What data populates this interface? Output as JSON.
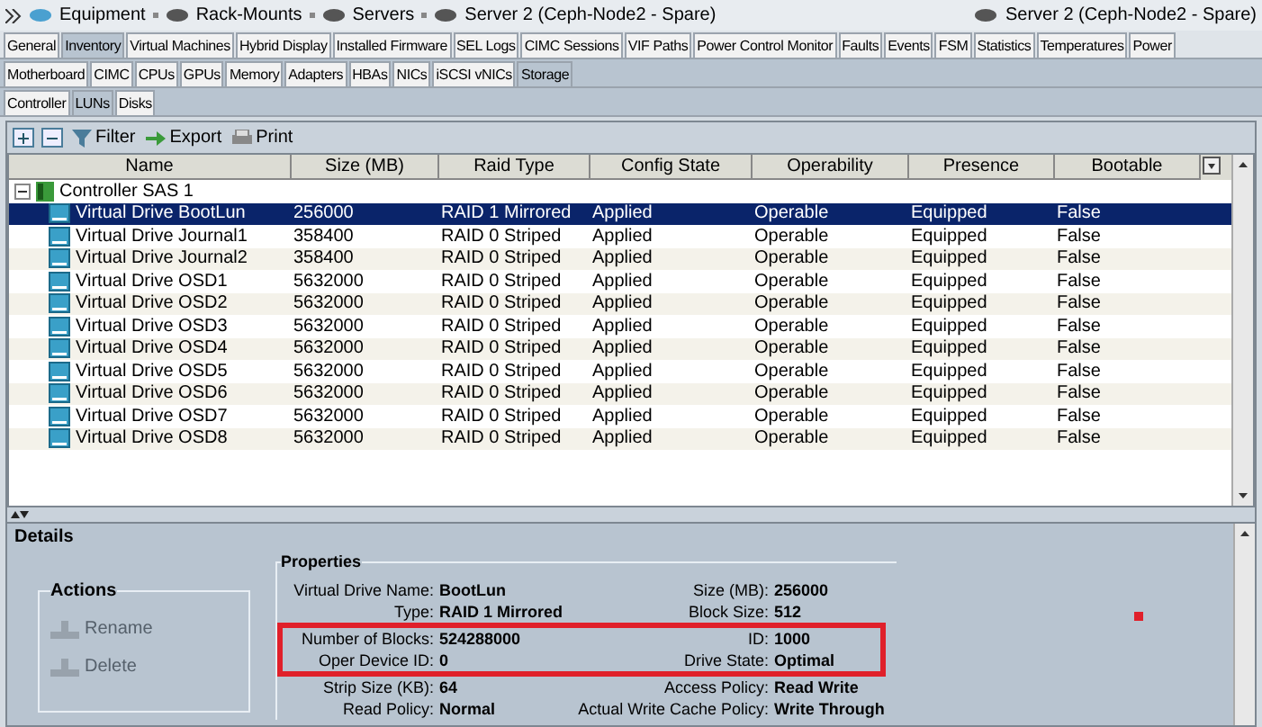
{
  "breadcrumb": {
    "items": [
      "Equipment",
      "Rack-Mounts",
      "Servers",
      "Server 2 (Ceph-Node2 - Spare)"
    ],
    "title": "Server 2 (Ceph-Node2 - Spare)"
  },
  "tabs": [
    {
      "label": "General",
      "selected": false
    },
    {
      "label": "Inventory",
      "selected": true
    },
    {
      "label": "Virtual Machines",
      "selected": false
    },
    {
      "label": "Hybrid Display",
      "selected": false
    },
    {
      "label": "Installed Firmware",
      "selected": false
    },
    {
      "label": "SEL Logs",
      "selected": false
    },
    {
      "label": "CIMC Sessions",
      "selected": false
    },
    {
      "label": "VIF Paths",
      "selected": false
    },
    {
      "label": "Power Control Monitor",
      "selected": false
    },
    {
      "label": "Faults",
      "selected": false
    },
    {
      "label": "Events",
      "selected": false
    },
    {
      "label": "FSM",
      "selected": false
    },
    {
      "label": "Statistics",
      "selected": false
    },
    {
      "label": "Temperatures",
      "selected": false
    },
    {
      "label": "Power",
      "selected": false
    }
  ],
  "subtabs": [
    {
      "label": "Motherboard",
      "selected": false
    },
    {
      "label": "CIMC",
      "selected": false
    },
    {
      "label": "CPUs",
      "selected": false
    },
    {
      "label": "GPUs",
      "selected": false
    },
    {
      "label": "Memory",
      "selected": false
    },
    {
      "label": "Adapters",
      "selected": false
    },
    {
      "label": "HBAs",
      "selected": false
    },
    {
      "label": "NICs",
      "selected": false
    },
    {
      "label": "iSCSI vNICs",
      "selected": false
    },
    {
      "label": "Storage",
      "selected": true
    }
  ],
  "storage_tabs": [
    {
      "label": "Controller",
      "selected": false
    },
    {
      "label": "LUNs",
      "selected": true
    },
    {
      "label": "Disks",
      "selected": false
    }
  ],
  "toolbar": {
    "buttons": [
      "Filter",
      "Export",
      "Print"
    ]
  },
  "table": {
    "columns": [
      "Name",
      "Size (MB)",
      "Raid Type",
      "Config State",
      "Operability",
      "Presence",
      "Bootable"
    ],
    "tree": [
      {
        "name": "Controller SAS 1",
        "expanded": true,
        "children": [
          {
            "cells": [
              "Virtual Drive BootLun",
              "256000",
              "RAID 1 Mirrored",
              "Applied",
              "Operable",
              "Equipped",
              "False"
            ],
            "selected": true
          },
          {
            "cells": [
              "Virtual Drive Journal1",
              "358400",
              "RAID 0 Striped",
              "Applied",
              "Operable",
              "Equipped",
              "False"
            ],
            "selected": false
          },
          {
            "cells": [
              "Virtual Drive Journal2",
              "358400",
              "RAID 0 Striped",
              "Applied",
              "Operable",
              "Equipped",
              "False"
            ],
            "selected": false
          },
          {
            "cells": [
              "Virtual Drive OSD1",
              "5632000",
              "RAID 0 Striped",
              "Applied",
              "Operable",
              "Equipped",
              "False"
            ],
            "selected": false
          },
          {
            "cells": [
              "Virtual Drive OSD2",
              "5632000",
              "RAID 0 Striped",
              "Applied",
              "Operable",
              "Equipped",
              "False"
            ],
            "selected": false
          },
          {
            "cells": [
              "Virtual Drive OSD3",
              "5632000",
              "RAID 0 Striped",
              "Applied",
              "Operable",
              "Equipped",
              "False"
            ],
            "selected": false
          },
          {
            "cells": [
              "Virtual Drive OSD4",
              "5632000",
              "RAID 0 Striped",
              "Applied",
              "Operable",
              "Equipped",
              "False"
            ],
            "selected": false
          },
          {
            "cells": [
              "Virtual Drive OSD5",
              "5632000",
              "RAID 0 Striped",
              "Applied",
              "Operable",
              "Equipped",
              "False"
            ],
            "selected": false
          },
          {
            "cells": [
              "Virtual Drive OSD6",
              "5632000",
              "RAID 0 Striped",
              "Applied",
              "Operable",
              "Equipped",
              "False"
            ],
            "selected": false
          },
          {
            "cells": [
              "Virtual Drive OSD7",
              "5632000",
              "RAID 0 Striped",
              "Applied",
              "Operable",
              "Equipped",
              "False"
            ],
            "selected": false
          },
          {
            "cells": [
              "Virtual Drive OSD8",
              "5632000",
              "RAID 0 Striped",
              "Applied",
              "Operable",
              "Equipped",
              "False"
            ],
            "selected": false
          }
        ]
      }
    ]
  },
  "details": {
    "title": "Details",
    "actions": {
      "title": "Actions",
      "items": [
        {
          "label": "Rename",
          "disabled": true
        },
        {
          "label": "Delete",
          "disabled": true
        }
      ]
    },
    "properties": {
      "title": "Properties",
      "groups": [
        {
          "highlighted": false,
          "rows": [
            {
              "left": {
                "label": "Virtual Drive Name:",
                "value": "BootLun"
              },
              "right": {
                "label": "Size (MB):",
                "value": "256000"
              }
            },
            {
              "left": {
                "label": "Type:",
                "value": "RAID 1 Mirrored"
              },
              "right": {
                "label": "Block Size:",
                "value": "512"
              }
            }
          ]
        },
        {
          "highlighted": true,
          "rows": [
            {
              "left": {
                "label": "Number of Blocks:",
                "value": "524288000"
              },
              "right": {
                "label": "ID:",
                "value": "1000"
              }
            },
            {
              "left": {
                "label": "Oper Device ID:",
                "value": "0"
              },
              "right": {
                "label": "Drive State:",
                "value": "Optimal"
              }
            }
          ]
        },
        {
          "highlighted": false,
          "rows": [
            {
              "left": {
                "label": "Strip Size (KB):",
                "value": "64"
              },
              "right": {
                "label": "Access Policy:",
                "value": "Read Write"
              }
            },
            {
              "left": {
                "label": "Read Policy:",
                "value": "Normal"
              },
              "right": {
                "label": "Actual Write Cache Policy:",
                "value": "Write Through"
              }
            }
          ]
        }
      ]
    }
  }
}
